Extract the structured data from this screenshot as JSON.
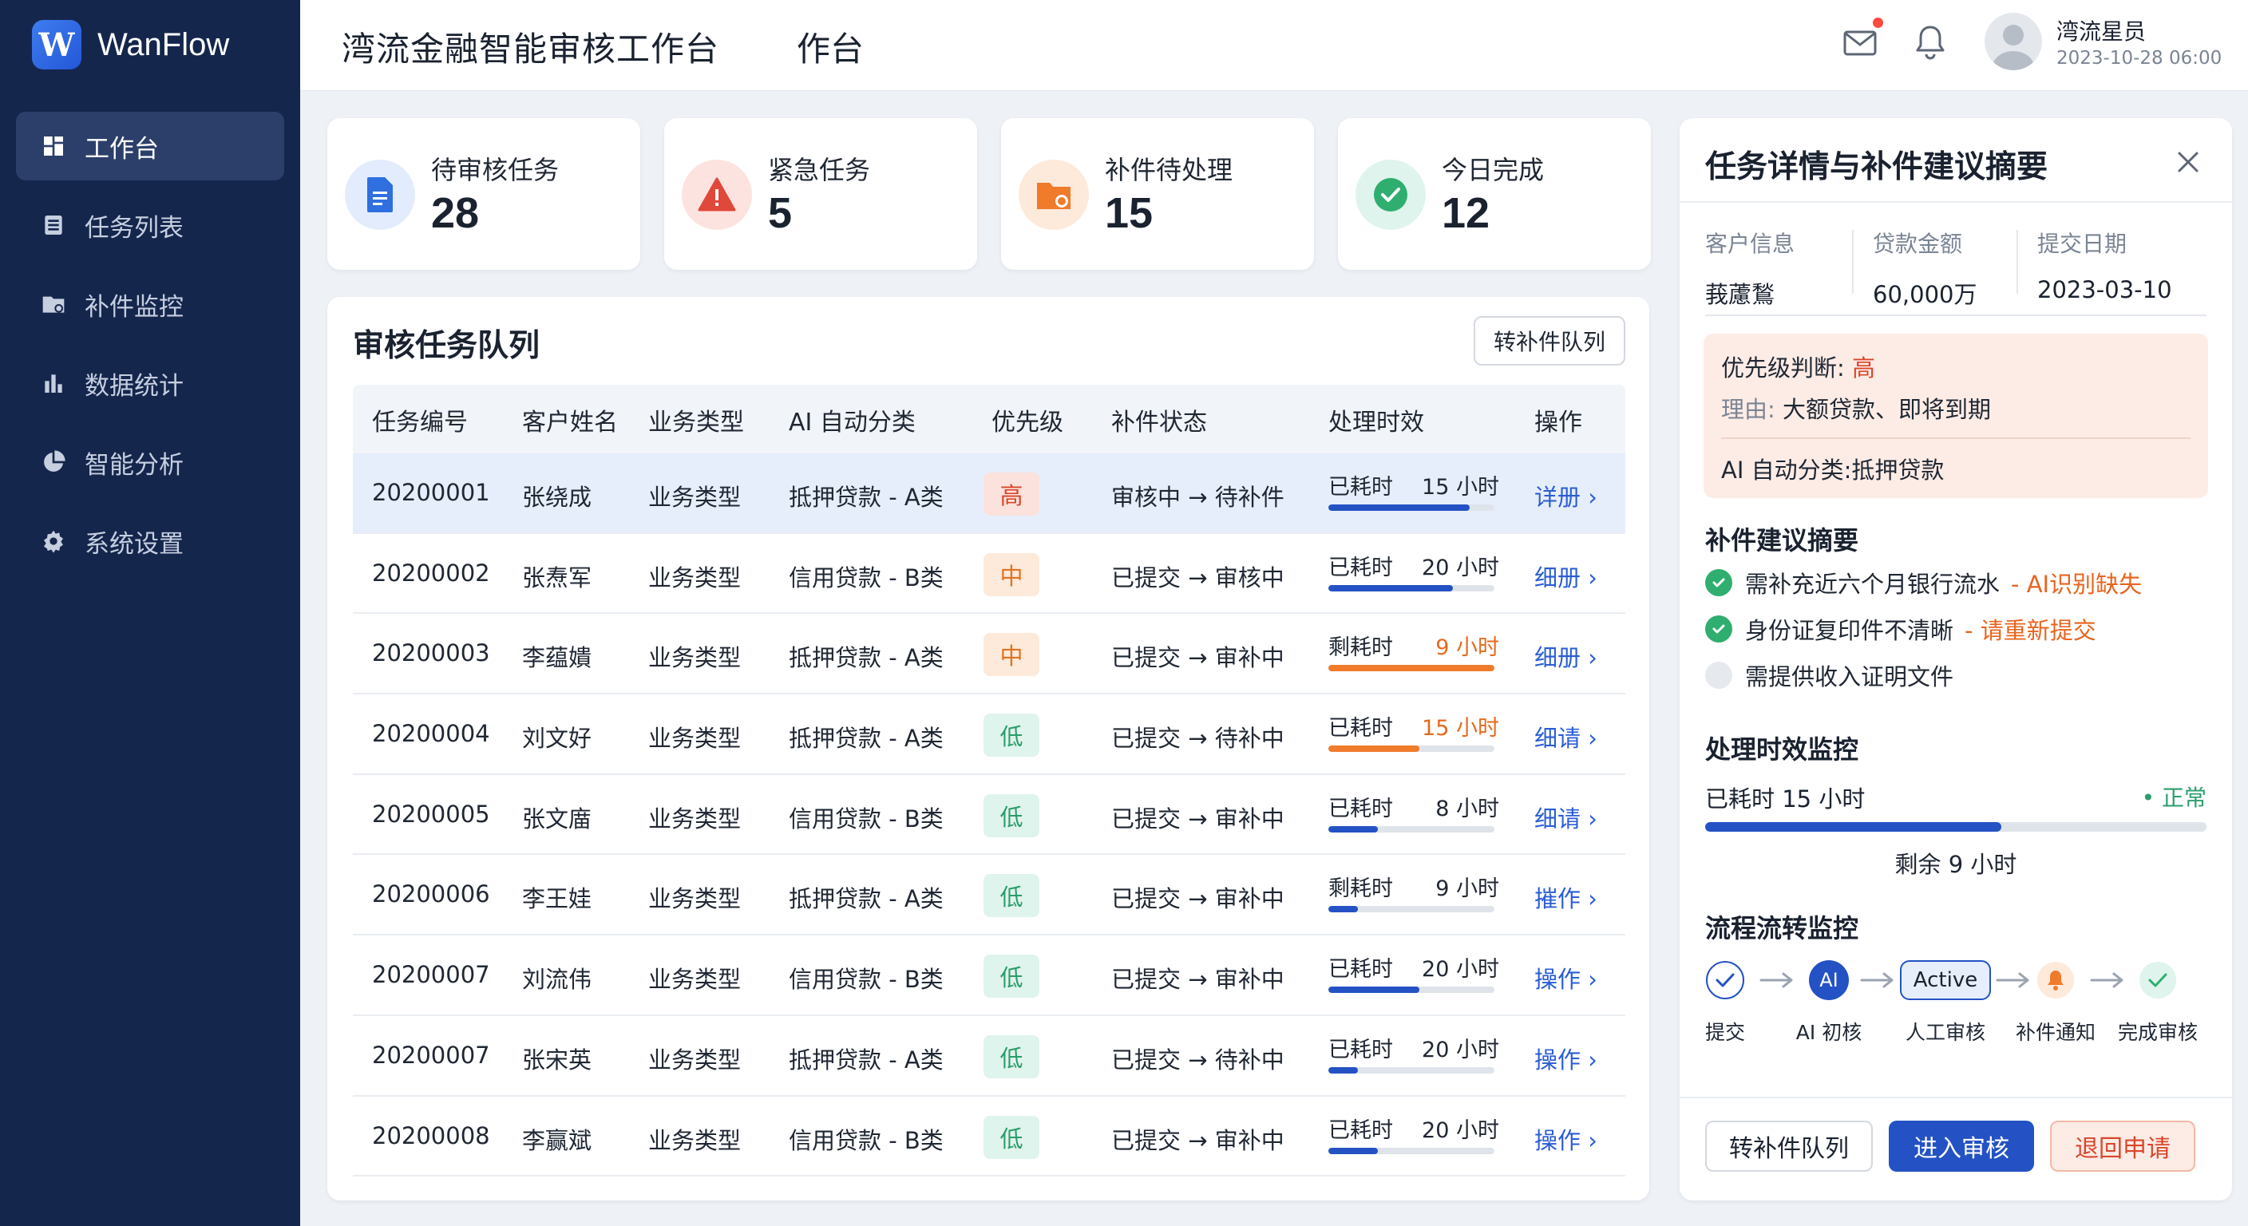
{
  "app": {
    "name": "WanFlow",
    "logo_letter": "W"
  },
  "header": {
    "title": "湾流金融智能审核工作台",
    "subtitle": "作台",
    "user_name": "湾流星员",
    "timestamp": "2023-10-28 06:00"
  },
  "sidebar": {
    "items": [
      {
        "label": "工作台",
        "icon": "dashboard-icon",
        "active": true
      },
      {
        "label": "任务列表",
        "icon": "list-icon"
      },
      {
        "label": "补件监控",
        "icon": "folder-monitor-icon"
      },
      {
        "label": "数据统计",
        "icon": "bar-chart-icon"
      },
      {
        "label": "智能分析",
        "icon": "pie-chart-icon"
      },
      {
        "label": "系统设置",
        "icon": "gear-icon"
      }
    ]
  },
  "stats": [
    {
      "label": "待审核任务",
      "value": "28",
      "icon": "document-icon",
      "color": "#2f6fe0"
    },
    {
      "label": "紧急任务",
      "value": "5",
      "icon": "warning-icon",
      "color": "#e0483a"
    },
    {
      "label": "补件待处理",
      "value": "15",
      "icon": "folder-icon",
      "color": "#ef7b2b"
    },
    {
      "label": "今日完成",
      "value": "12",
      "icon": "check-circle-icon",
      "color": "#2fae6f"
    }
  ],
  "queue": {
    "title": "审核任务队列",
    "action_label": "转补件队列",
    "columns": [
      "任务编号",
      "客户姓名",
      "业务类型",
      "AI 自动分类",
      "优先级",
      "补件状态",
      "处理时效",
      "操作"
    ],
    "rows": [
      {
        "id": "20200001",
        "name": "张绕成",
        "type": "业务类型",
        "ai": "抵押贷款 - A类",
        "priority": "高",
        "level": "high",
        "status": "审核中 → 待补件",
        "time_label": "已耗时",
        "hours": "15 小时",
        "progress": 0.85,
        "warn": false,
        "op": "详册",
        "selected": true
      },
      {
        "id": "20200002",
        "name": "张焘军",
        "type": "业务类型",
        "ai": "信用贷款 - B类",
        "priority": "中",
        "level": "mid",
        "status": "已提交 → 审核中",
        "time_label": "已耗时",
        "hours": "20 小时",
        "progress": 0.75,
        "warn": false,
        "op": "细册"
      },
      {
        "id": "20200003",
        "name": "李蕴嬇",
        "type": "业务类型",
        "ai": "抵押贷款 - A类",
        "priority": "中",
        "level": "mid",
        "status": "已提交 → 审补中",
        "time_label": "剩耗时",
        "hours": "9 小时",
        "progress": 1.0,
        "warn": true,
        "op": "细册"
      },
      {
        "id": "20200004",
        "name": "刘文好",
        "type": "业务类型",
        "ai": "抵押贷款 - A类",
        "priority": "低",
        "level": "low",
        "status": "已提交 → 待补中",
        "time_label": "已耗时",
        "hours": "15 小时",
        "progress": 0.55,
        "warn": true,
        "op": "细请"
      },
      {
        "id": "20200005",
        "name": "张文庿",
        "type": "业务类型",
        "ai": "信用贷款 - B类",
        "priority": "低",
        "level": "low",
        "status": "已提交 → 审补中",
        "time_label": "已耗时",
        "hours": "8 小时",
        "progress": 0.3,
        "warn": false,
        "op": "细请"
      },
      {
        "id": "20200006",
        "name": "李王娃",
        "type": "业务类型",
        "ai": "抵押贷款 - A类",
        "priority": "低",
        "level": "low",
        "status": "已提交 → 审补中",
        "time_label": "剩耗时",
        "hours": "9 小时",
        "progress": 0.18,
        "warn": false,
        "op": "摧作"
      },
      {
        "id": "20200007",
        "name": "刘流伟",
        "type": "业务类型",
        "ai": "信用贷款 - B类",
        "priority": "低",
        "level": "low",
        "status": "已提交 → 审补中",
        "time_label": "已耗时",
        "hours": "20 小时",
        "progress": 0.55,
        "warn": false,
        "op": "操作"
      },
      {
        "id": "20200007",
        "name": "张宋英",
        "type": "业务类型",
        "ai": "抵押贷款 - A类",
        "priority": "低",
        "level": "low",
        "status": "已提交 → 待补中",
        "time_label": "已耗时",
        "hours": "20 小时",
        "progress": 0.18,
        "warn": false,
        "op": "操作"
      },
      {
        "id": "20200008",
        "name": "李赢斌",
        "type": "业务类型",
        "ai": "信用贷款 - B类",
        "priority": "低",
        "level": "low",
        "status": "已提交 → 审补中",
        "time_label": "已耗时",
        "hours": "20 小时",
        "progress": 0.3,
        "warn": false,
        "op": "操作"
      }
    ]
  },
  "detail": {
    "title": "任务详情与补件建议摘要",
    "customer_key": "客户信息",
    "customer_val": "莪藘鶖",
    "amount_key": "贷款金额",
    "amount_val": "60,000万",
    "date_key": "提交日期",
    "date_val": "2023-03-10",
    "priority_prefix": "优先级判断:",
    "priority_value": "高",
    "reason_key": "理由:",
    "reason_val": "大额贷款、即将到期",
    "ai_class": "AI 自动分类:抵押贷款",
    "suggest_title": "补件建议摘要",
    "suggestions": [
      {
        "text": "需补充近六个月银行流水",
        "note": "- AI识别缺失",
        "done": true
      },
      {
        "text": "身份证复印件不清晰",
        "note": "- 请重新提交",
        "done": true
      },
      {
        "text": "需提供收入证明文件",
        "note": "",
        "done": false
      }
    ],
    "sla_title": "处理时效监控",
    "sla_label": "已耗时 15 小时",
    "sla_status": "• 正常",
    "sla_progress": 0.59,
    "sla_remaining": "剩余 9 小时",
    "flow_title": "流程流转监控",
    "flow": [
      {
        "label": "提交",
        "state": "done"
      },
      {
        "label": "AI 初核",
        "node": "AI",
        "state": "ai"
      },
      {
        "label": "人工审核",
        "node": "Active",
        "state": "active"
      },
      {
        "label": "补件通知",
        "state": "bell"
      },
      {
        "label": "完成审核",
        "state": "pending"
      }
    ],
    "btn_queue": "转补件队列",
    "btn_review": "进入审核",
    "btn_return": "退回申请"
  }
}
